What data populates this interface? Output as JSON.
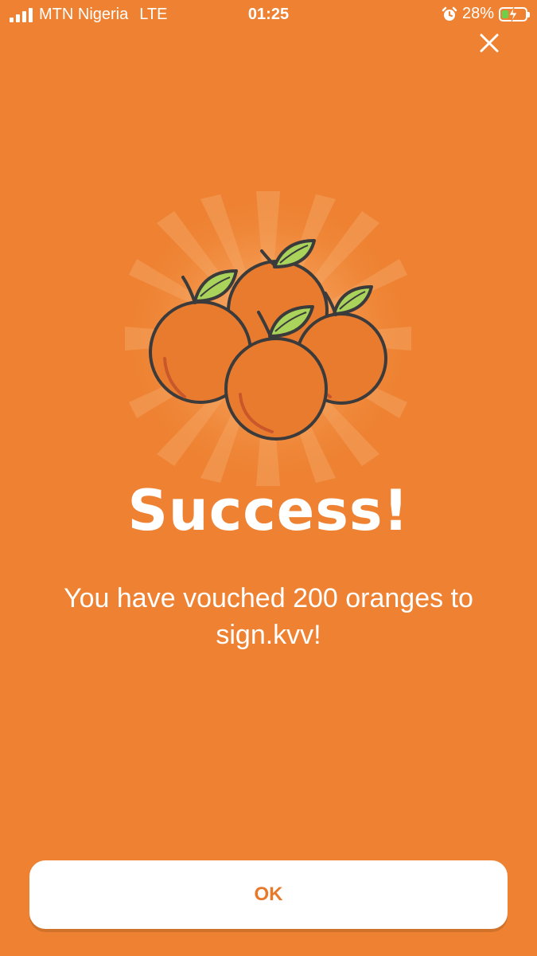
{
  "status_bar": {
    "carrier": "MTN Nigeria",
    "network": "LTE",
    "time": "01:25",
    "battery_percent": "28%",
    "battery_level": 0.28
  },
  "icons": {
    "signal": "signal-bars-icon",
    "alarm": "alarm-clock-icon",
    "battery": "battery-charging-icon",
    "close": "close-icon",
    "illustration": "oranges-illustration"
  },
  "dialog": {
    "title": "Success!",
    "message": "You have vouched 200 oranges to sign.kvv!",
    "ok_label": "OK"
  },
  "colors": {
    "background": "#EE8232",
    "orange_fruit": "#E97B2F",
    "leaf": "#A9D35A",
    "outline": "#3B3B3B",
    "button_text": "#E8792B"
  }
}
